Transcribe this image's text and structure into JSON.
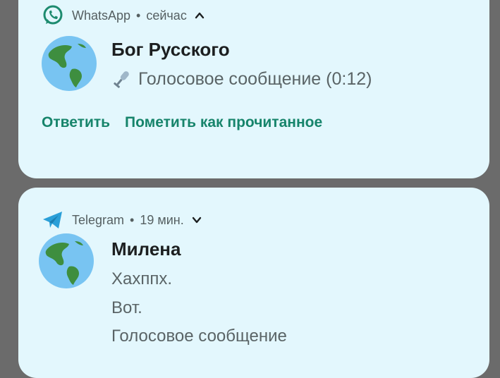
{
  "whatsapp": {
    "app": "WhatsApp",
    "time": "сейчас",
    "sender": "Бог Русского",
    "message": "Голосовое сообщение (0:12)",
    "actions": [
      "Ответить",
      "Пометить как прочитанное"
    ],
    "icon": "whatsapp-icon",
    "accent": "#16846b"
  },
  "telegram": {
    "app": "Telegram",
    "time": "19 мин.",
    "sender": "Милена",
    "lines": [
      "Хахппх.",
      "Вот.",
      "Голосовое сообщение"
    ],
    "icon": "telegram-icon",
    "accent": "#2a9fd8"
  },
  "colors": {
    "card_bg": "#e3f7fd",
    "backdrop": "#6b6b6b"
  }
}
